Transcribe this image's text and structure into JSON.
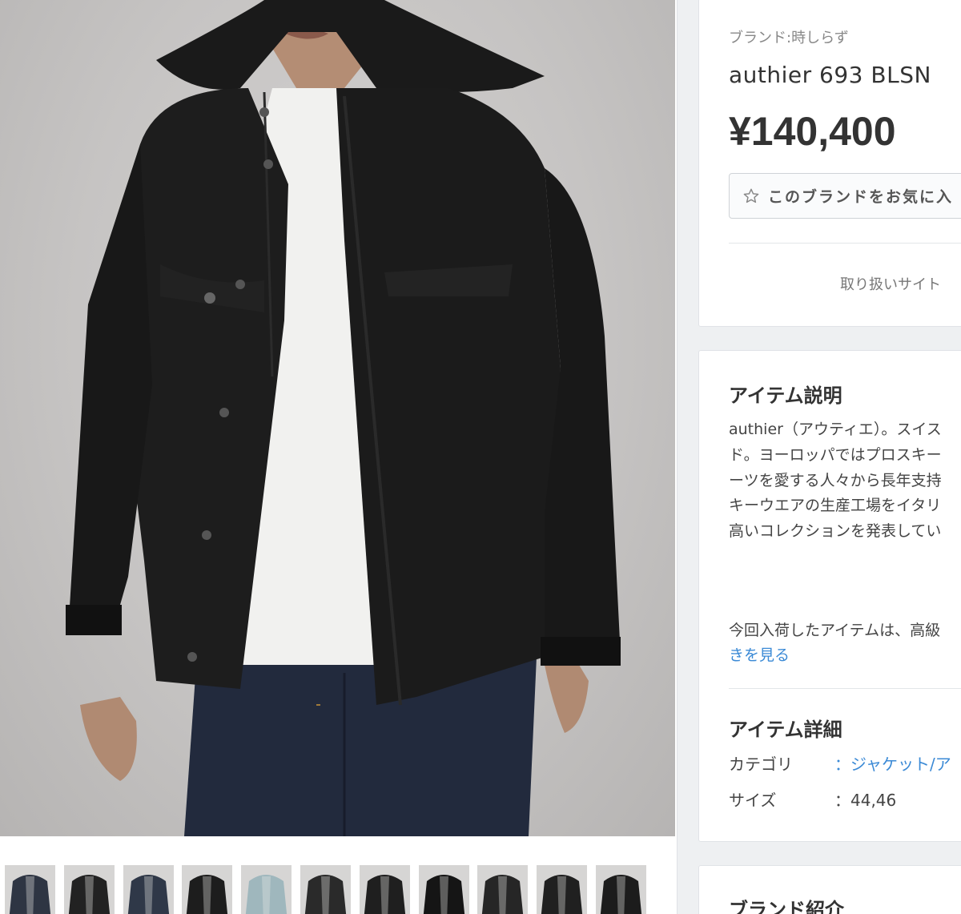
{
  "product": {
    "brand_label": "ブランド:",
    "brand_name": "時しらず",
    "name": "authier 693 BLSN",
    "price": "¥140,400",
    "favorite_button_label": "このブランドをお気に入",
    "sites_label": "取り扱いサイト"
  },
  "description": {
    "title": "アイテム説明",
    "lines": [
      "authier（アウティエ）。スイス",
      "ド。ヨーロッパではプロスキー",
      "ーツを愛する人々から長年支持",
      "キーウエアの生産工場をイタリ",
      "高いコレクションを発表してい"
    ],
    "extra_line": "今回入荷したアイテムは、高級",
    "read_more": "きを見る"
  },
  "details": {
    "title": "アイテム詳細",
    "rows": [
      {
        "key": "カテゴリ",
        "value": "：ジャケット/ア"
      },
      {
        "key": "サイズ",
        "value": "：44,46"
      }
    ]
  },
  "brand_intro": {
    "title": "ブランド紹介"
  },
  "gallery": {
    "thumbnail_colors": [
      "#2e3543",
      "#222222",
      "#2f3848",
      "#1d1d1d",
      "#9fb7bd",
      "#2a2a2a",
      "#1f1f1f",
      "#151515",
      "#262626",
      "#202020",
      "#1c1c1c"
    ]
  },
  "colors": {
    "link": "#3b8ad6",
    "jacket": "#1b1b1b",
    "denim": "#222a3d"
  }
}
